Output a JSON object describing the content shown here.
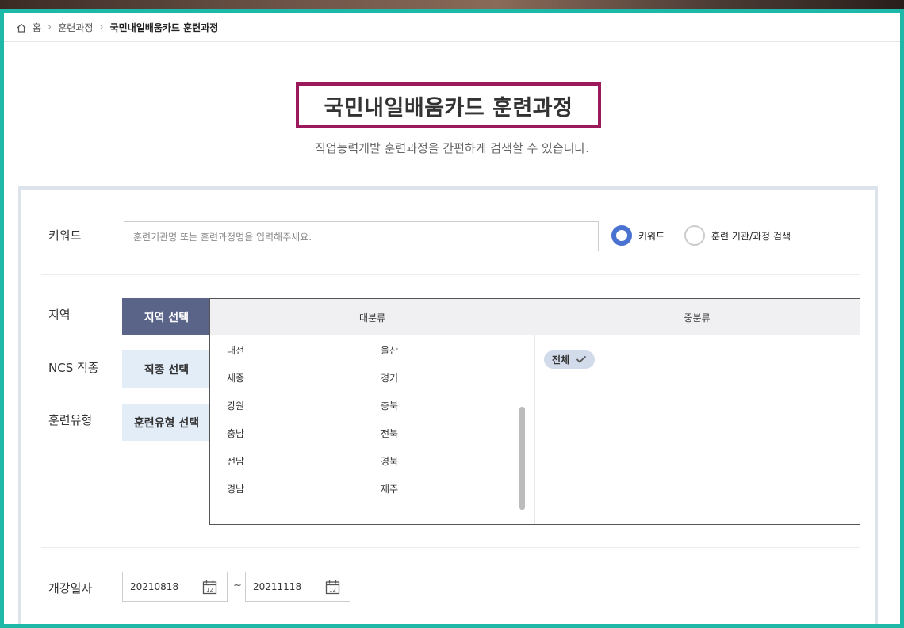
{
  "breadcrumb": [
    "홈",
    "훈련과정",
    "국민내일배움카드 훈련과정"
  ],
  "title": "국민내일배움카드 훈련과정",
  "subtitle": "직업능력개발 훈련과정을 간편하게 검색할 수 있습니다.",
  "search": {
    "keyword_label": "키워드",
    "keyword_placeholder": "훈련기관명 또는 훈련과정명을 입력해주세요.",
    "radio_options": [
      "키워드",
      "훈련 기관/과정 검색"
    ],
    "selected_radio": "키워드"
  },
  "filters": {
    "region_label": "지역",
    "ncs_label": "NCS 직종",
    "type_label": "훈련유형",
    "region_button": "지역 선택",
    "ncs_button": "직종 선택",
    "type_button": "훈련유형 선택",
    "active_tab": "지역 선택"
  },
  "region": {
    "major_header": "대분류",
    "minor_header": "중분류",
    "majors": [
      "대전",
      "울산",
      "세종",
      "경기",
      "강원",
      "충북",
      "충남",
      "전북",
      "전남",
      "경북",
      "경남",
      "제주"
    ],
    "minor_selected": "전체"
  },
  "dates": {
    "label": "개강일자",
    "start": "20210818",
    "end": "20211118",
    "separator": "~",
    "calendar_day": "12"
  },
  "colors": {
    "frame": "#1db8a8",
    "title_highlight": "#9c1a5c",
    "active_tab": "#5a6489",
    "inactive_tab": "#e3edf8",
    "radio_selected": "#4a72d0",
    "chip": "#d2dbe9"
  }
}
